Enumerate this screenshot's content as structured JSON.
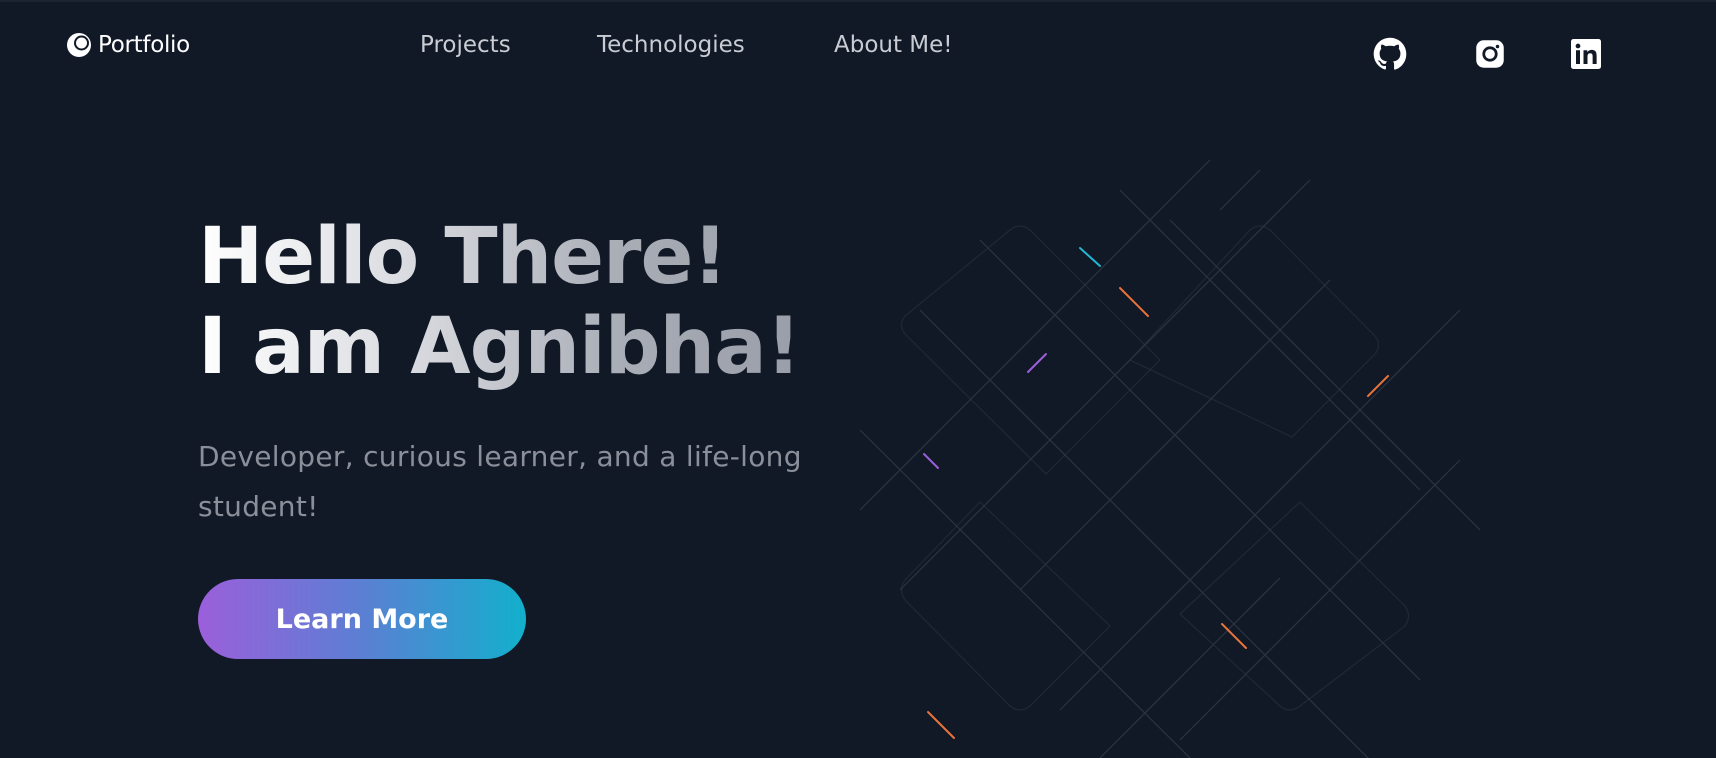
{
  "nav": {
    "logo_text": "Portfolio",
    "links": [
      {
        "label": "Projects"
      },
      {
        "label": "Technologies"
      },
      {
        "label": "About Me!"
      }
    ],
    "social": [
      {
        "icon": "github-icon"
      },
      {
        "icon": "instagram-icon"
      },
      {
        "icon": "linkedin-icon"
      }
    ]
  },
  "hero": {
    "title_line1": "Hello There!",
    "title_line2": "I am Agnibha!",
    "subtitle": "Developer, curious learner, and a life-long student!",
    "cta_label": "Learn More"
  },
  "colors": {
    "background": "#111826",
    "gradient_start": "#9b5fdb",
    "gradient_end": "#12b0cc",
    "text_muted": "#8b8f99"
  }
}
